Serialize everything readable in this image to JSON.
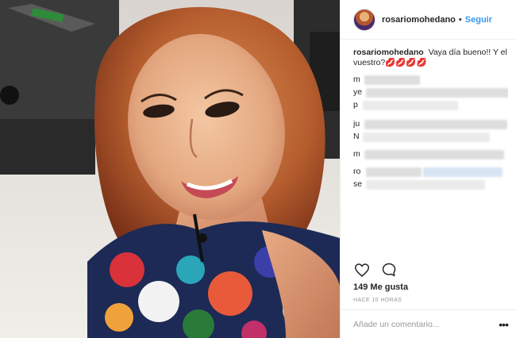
{
  "post": {
    "username": "rosariomohedano",
    "separator": "•",
    "follow_label": "Seguir",
    "caption_text": "Vaya día bueno!! Y el vuestro?💋💋💋💋",
    "likes": "149 Me gusta",
    "timestamp": "HACE 10 HORAS",
    "comment_placeholder": "Añade un comentario...",
    "more_label": "•••"
  },
  "comments": [
    {
      "letter": "m"
    },
    {
      "letter": "ye"
    },
    {
      "letter": "p"
    },
    {
      "letter": "ju"
    },
    {
      "letter": "N"
    },
    {
      "letter": "m"
    },
    {
      "letter": "ro"
    },
    {
      "letter": "se"
    }
  ],
  "icons": {
    "like": "heart-icon",
    "comment": "comment-bubble-icon",
    "avatar": "user-avatar"
  },
  "colors": {
    "link_blue": "#3897f0",
    "text": "#262626",
    "muted": "#999999",
    "border": "#efefef"
  }
}
